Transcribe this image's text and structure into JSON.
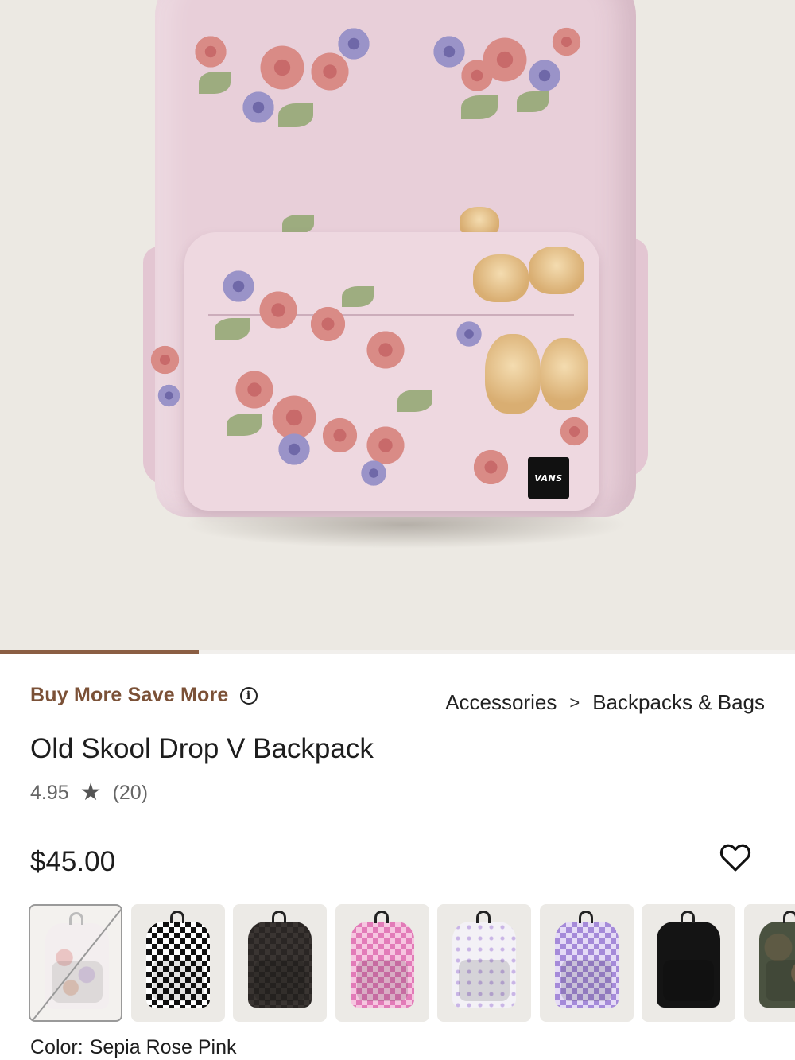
{
  "hero": {
    "image_label": "Old Skool Drop V Backpack product photo",
    "brand_tag": "VANS",
    "gallery_progress": 0.25
  },
  "colors": {
    "accent": "#7b5137",
    "progress": "#8b5e43",
    "hero_bg": "#ece9e3"
  },
  "promo": {
    "label": "Buy More Save More",
    "info_icon": "info-icon"
  },
  "breadcrumb": {
    "items": [
      "Accessories",
      "Backpacks & Bags"
    ],
    "separator": ">"
  },
  "product": {
    "title": "Old Skool Drop V Backpack",
    "rating": "4.95",
    "review_count": "(20)",
    "price": "$45.00"
  },
  "wishlist": {
    "icon": "heart-icon"
  },
  "swatches": [
    {
      "name": "Sepia Rose Pink",
      "style": "floral",
      "selected": true,
      "unavailable": true
    },
    {
      "name": "checkerboard-black-white",
      "style": "checker-bw"
    },
    {
      "name": "black-checker",
      "style": "solid-dark"
    },
    {
      "name": "pink-checker",
      "style": "checker-pink"
    },
    {
      "name": "white-dots",
      "style": "dots"
    },
    {
      "name": "purple-checker",
      "style": "checker-purple"
    },
    {
      "name": "black",
      "style": "black"
    },
    {
      "name": "camo",
      "style": "camo"
    }
  ],
  "color_selection": {
    "label": "Color:",
    "value": "Sepia Rose Pink"
  }
}
